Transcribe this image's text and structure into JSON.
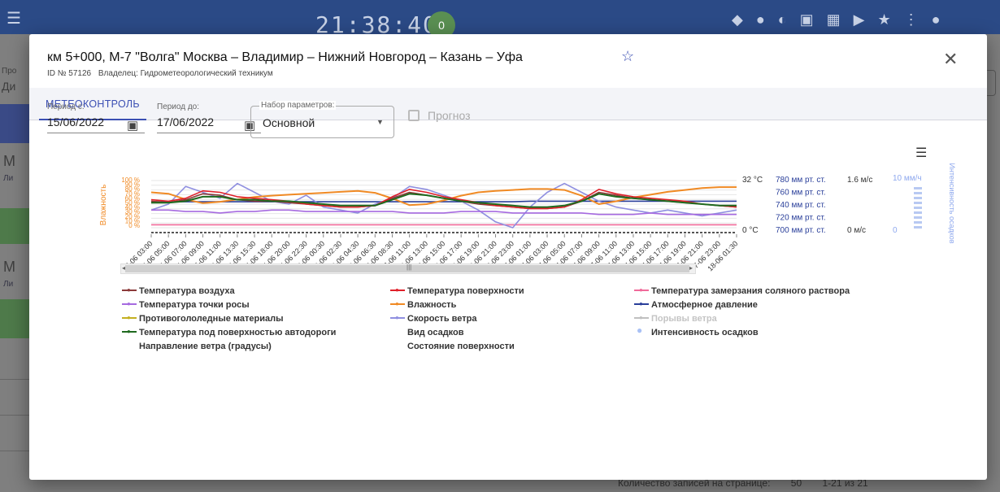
{
  "background": {
    "clock": "21:38:40",
    "badge": "0",
    "label_period": "Про",
    "label_di": "Ди",
    "label_m1": "М",
    "label_li1": "Ли",
    "label_m2": "М",
    "label_li2": "Ли",
    "footer": {
      "per_page_label": "Количество записей на странице:",
      "per_page_value": "50",
      "range": "1-21 из 21"
    }
  },
  "dialog": {
    "title": "км 5+000, М-7 \"Волга\" Москва – Владимир – Нижний Новгород – Казань – Уфа",
    "id_text": "ID № 57126",
    "owner_text": "Владелец: Гидрометеорологический техникум",
    "tab": "МЕТЕОКОНТРОЛЬ"
  },
  "filters": {
    "period_from_label": "Период с:",
    "period_from_value": "15/06/2022",
    "period_to_label": "Период до:",
    "period_to_value": "17/06/2022",
    "param_set_label": "Набор параметров:",
    "param_set_value": "Основной",
    "forecast_label": "Прогноз"
  },
  "chart_data": {
    "type": "line",
    "y_left_label": "Влажность",
    "y_left_ticks": [
      "100 %",
      "90 %",
      "80 %",
      "70 %",
      "60 %",
      "50 %",
      "40 %",
      "30 %",
      "20 %",
      "10 %",
      "0 %"
    ],
    "y_right_label": "Интенсивность осадков",
    "axis_temp": {
      "max": "32 °C",
      "min": "0 °C"
    },
    "axis_pressure": [
      "780 мм рт. ст.",
      "760 мм рт. ст.",
      "740 мм рт. ст.",
      "720 мм рт. ст.",
      "700 мм рт. ст."
    ],
    "axis_wind": {
      "max": "1.6 м/с",
      "min": "0 м/с"
    },
    "axis_precip": {
      "max": "10 мм/ч",
      "min": "0"
    },
    "categories": [
      "15-06 03:00",
      "15-06 05:00",
      "15-06 07:00",
      "15-06 09:00",
      "15-06 11:00",
      "15-06 13:30",
      "15-06 15:30",
      "15-06 18:00",
      "15-06 20:00",
      "15-06 22:30",
      "16-06 00:30",
      "16-06 02:30",
      "16-06 04:30",
      "16-06 06:30",
      "16-06 08:30",
      "16-06 11:00",
      "16-06 13:00",
      "16-06 15:00",
      "16-06 17:00",
      "16-06 19:00",
      "16-06 21:00",
      "16-06 23:00",
      "17-06 01:00",
      "17-06 03:00",
      "17-06 05:00",
      "17-06 07:00",
      "17-06 09:00",
      "17-06 11:00",
      "17-06 13:00",
      "17-06 15:00",
      "17-06 17:00",
      "17-06 19:00",
      "17-06 21:00",
      "17-06 23:00",
      "18-06 01:30"
    ],
    "series": [
      {
        "name": "Температура воздуха",
        "color": "#8b3a3a",
        "axis": "temp",
        "values": [
          18,
          17,
          19,
          23,
          22,
          19,
          18,
          18,
          17,
          16,
          15,
          14,
          14,
          15,
          20,
          24,
          22,
          20,
          18,
          16,
          15,
          14,
          13,
          13,
          14,
          18,
          24,
          22,
          20,
          19,
          18,
          17,
          16,
          15,
          14
        ]
      },
      {
        "name": "Температура поверхности",
        "color": "#e0202a",
        "axis": "temp",
        "values": [
          19,
          18,
          20,
          25,
          24,
          21,
          20,
          19,
          18,
          16,
          15,
          14,
          14,
          15,
          21,
          26,
          24,
          21,
          19,
          17,
          15,
          14,
          13,
          13,
          14,
          19,
          26,
          23,
          21,
          20,
          19,
          18,
          16,
          15,
          14
        ]
      },
      {
        "name": "Температура замерзания соляного раствора",
        "color": "#f06a9a",
        "axis": "temp",
        "values": [
          2,
          2,
          2,
          2,
          2,
          2,
          2,
          2,
          2,
          2,
          2,
          2,
          2,
          2,
          2,
          2,
          2,
          2,
          2,
          2,
          2,
          2,
          2,
          2,
          2,
          2,
          2,
          2,
          2,
          2,
          2,
          2,
          2,
          2,
          2
        ]
      },
      {
        "name": "Температура точки росы",
        "color": "#a66ae0",
        "axis": "temp",
        "values": [
          12,
          12,
          11,
          11,
          10,
          11,
          11,
          12,
          12,
          11,
          11,
          11,
          11,
          11,
          11,
          10,
          10,
          10,
          11,
          11,
          11,
          10,
          10,
          10,
          10,
          10,
          9,
          9,
          9,
          10,
          9,
          9,
          9,
          9,
          9
        ]
      },
      {
        "name": "Влажность",
        "color": "#f08a24",
        "axis": "humidity",
        "values": [
          75,
          72,
          60,
          52,
          55,
          60,
          65,
          68,
          70,
          72,
          74,
          76,
          78,
          74,
          62,
          48,
          50,
          58,
          68,
          75,
          78,
          80,
          82,
          82,
          80,
          68,
          50,
          56,
          64,
          70,
          76,
          80,
          84,
          86,
          86
        ]
      },
      {
        "name": "Атмосферное давление",
        "color": "#2a3f9a",
        "axis": "pressure",
        "values": [
          744,
          744,
          744,
          744,
          744,
          744,
          744,
          744,
          744,
          744,
          744,
          744,
          744,
          744,
          744,
          744,
          744,
          744,
          744,
          744,
          744,
          744,
          745,
          745,
          745,
          745,
          745,
          745,
          745,
          745,
          745,
          745,
          745,
          745,
          745
        ]
      },
      {
        "name": "Противогололедные материалы",
        "color": "#c4b020",
        "axis": "temp",
        "values": []
      },
      {
        "name": "Скорость ветра",
        "color": "#8f8fe0",
        "axis": "wind",
        "values": [
          0.6,
          0.8,
          1.4,
          1.2,
          1.0,
          1.5,
          1.2,
          0.9,
          0.8,
          1.1,
          0.7,
          0.6,
          0.5,
          0.8,
          1.0,
          1.4,
          1.3,
          1.1,
          0.9,
          0.6,
          0.2,
          0.0,
          0.7,
          1.2,
          1.5,
          1.2,
          0.9,
          0.7,
          0.6,
          0.5,
          0.6,
          0.5,
          0.4,
          0.5,
          0.6
        ]
      },
      {
        "name": "Порывы ветра",
        "color": "#c0c0c0",
        "axis": "wind",
        "values": []
      },
      {
        "name": "Температура под поверхностью автодороги",
        "color": "#1f6a1f",
        "axis": "temp",
        "values": [
          17,
          17,
          18,
          21,
          21,
          19,
          19,
          18,
          18,
          17,
          16,
          15,
          15,
          15,
          19,
          23,
          22,
          20,
          18,
          17,
          16,
          15,
          14,
          14,
          15,
          18,
          23,
          21,
          20,
          19,
          18,
          17,
          16,
          15,
          15
        ]
      },
      {
        "name": "Вид осадков",
        "color": "",
        "axis": "",
        "values": []
      },
      {
        "name": "Интенсивность осадков",
        "color": "#a9c1f5",
        "axis": "precip",
        "values": []
      },
      {
        "name": "Направление ветра (градусы)",
        "color": "",
        "axis": "",
        "values": []
      },
      {
        "name": "Состояние поверхности",
        "color": "",
        "axis": "",
        "values": []
      }
    ]
  },
  "icons": {
    "star": "star-outline-icon",
    "close": "close-icon",
    "calendar": "calendar-icon",
    "menu": "hamburger-menu-icon"
  },
  "colors": {
    "primary": "#3b4fb3",
    "header_bg": "#2b4a86"
  }
}
